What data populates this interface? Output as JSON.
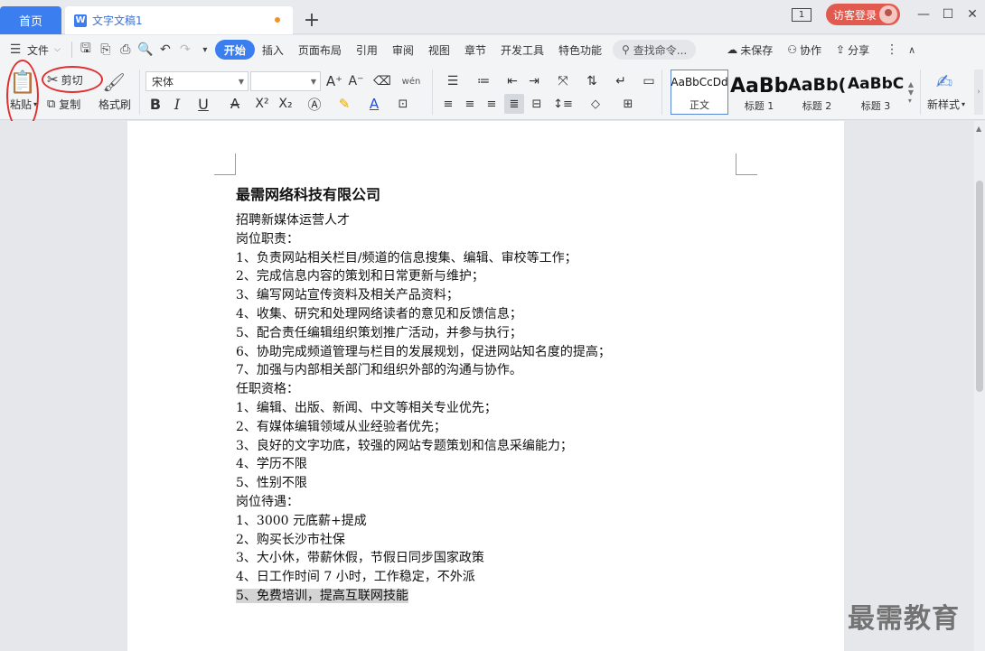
{
  "tabs": {
    "home": "首页",
    "document": "文字文稿1",
    "add": "+"
  },
  "title_bar": {
    "window_count": "1",
    "login": "访客登录",
    "minimize": "—",
    "maximize": "☐",
    "close": "✕"
  },
  "menu": {
    "file": "文件",
    "items": [
      "开始",
      "插入",
      "页面布局",
      "引用",
      "审阅",
      "视图",
      "章节",
      "开发工具",
      "特色功能"
    ],
    "active": "开始",
    "search": "查找命令...",
    "unsaved": "未保存",
    "collab": "协作",
    "share": "分享"
  },
  "ribbon": {
    "paste": "粘贴",
    "cut": "剪切",
    "copy": "复制",
    "format_painter": "格式刷",
    "font_name": "宋体",
    "font_size": "",
    "bold": "B",
    "italic": "I",
    "underline": "U",
    "strike": "A",
    "superscript": "X²",
    "subscript": "X₂",
    "phonetic": "wén",
    "styles": [
      {
        "sample": "AaBbCcDd",
        "name": "正文"
      },
      {
        "sample": "AaBb",
        "name": "标题 1"
      },
      {
        "sample": "AaBb(",
        "name": "标题 2"
      },
      {
        "sample": "AaBbC",
        "name": "标题 3"
      }
    ],
    "new_style": "新样式"
  },
  "document": {
    "title": "最需网络科技有限公司",
    "lines": [
      "招聘新媒体运营人才",
      "岗位职责：",
      "1、负责网站相关栏目/频道的信息搜集、编辑、审校等工作；",
      "2、完成信息内容的策划和日常更新与维护；",
      "3、编写网站宣传资料及相关产品资料；",
      "4、收集、研究和处理网络读者的意见和反馈信息；",
      "5、配合责任编辑组织策划推广活动，并参与执行；",
      "6、协助完成频道管理与栏目的发展规划，促进网站知名度的提高；",
      "7、加强与内部相关部门和组织外部的沟通与协作。",
      "任职资格：",
      "1、编辑、出版、新闻、中文等相关专业优先；",
      "2、有媒体编辑领域从业经验者优先；",
      "3、良好的文字功底，较强的网站专题策划和信息采编能力；",
      "4、学历不限",
      "5、性别不限",
      "岗位待遇：",
      "1、3000 元底薪+提成",
      "2、购买长沙市社保",
      "3、大小休，带薪休假，节假日同步国家政策",
      "4、日工作时间 7 小时，工作稳定，不外派"
    ],
    "selected_line": "5、免费培训，提高互联网技能"
  },
  "watermark": "最需教育"
}
